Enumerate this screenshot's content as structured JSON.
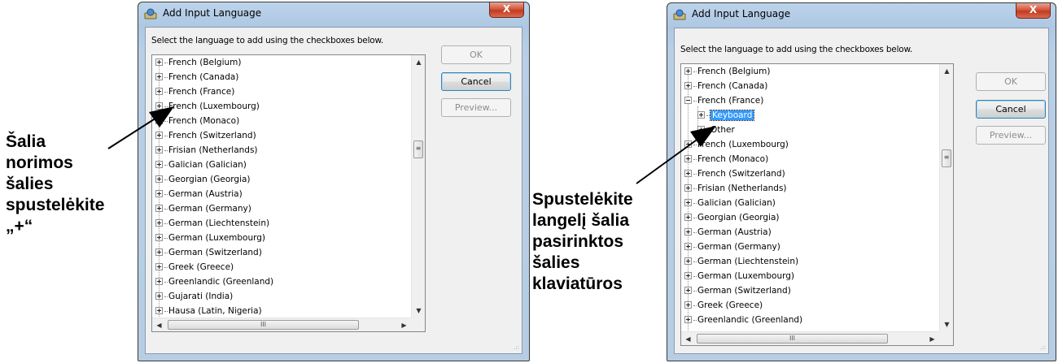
{
  "left_annotation": {
    "lines": [
      "Šalia",
      "norimos",
      "šalies",
      "spustelėkite",
      "„+“"
    ]
  },
  "right_annotation": {
    "lines": [
      "Spustelėkite",
      "langelį šalia",
      "pasirinktos",
      "šalies",
      "klaviatūros"
    ]
  },
  "dialog_left": {
    "title": "Add Input Language",
    "close_label": "X",
    "instruction": "Select the language to add using the checkboxes below.",
    "ok_label": "OK",
    "cancel_label": "Cancel",
    "preview_label": "Preview...",
    "items": [
      "French (Belgium)",
      "French (Canada)",
      "French (France)",
      "French (Luxembourg)",
      "French (Monaco)",
      "French (Switzerland)",
      "Frisian (Netherlands)",
      "Galician (Galician)",
      "Georgian (Georgia)",
      "German (Austria)",
      "German (Germany)",
      "German (Liechtenstein)",
      "German (Luxembourg)",
      "German (Switzerland)",
      "Greek (Greece)",
      "Greenlandic (Greenland)",
      "Gujarati (India)",
      "Hausa (Latin, Nigeria)"
    ]
  },
  "dialog_right": {
    "title": "Add Input Language",
    "close_label": "X",
    "instruction": "Select the language to add using the checkboxes below.",
    "ok_label": "OK",
    "cancel_label": "Cancel",
    "preview_label": "Preview...",
    "items": [
      "French (Belgium)",
      "French (Canada)",
      "French (France)",
      "Keyboard",
      "Other",
      "French (Luxembourg)",
      "French (Monaco)",
      "French (Switzerland)",
      "Frisian (Netherlands)",
      "Galician (Galician)",
      "Georgian (Georgia)",
      "German (Austria)",
      "German (Germany)",
      "German (Liechtenstein)",
      "German (Luxembourg)",
      "German (Switzerland)",
      "Greek (Greece)",
      "Greenlandic (Greenland)"
    ],
    "selected_item": "Keyboard"
  },
  "scroll_thumb_glyph": "III",
  "colors": {
    "titlebar": "#aec8e3",
    "selection": "#3399ff",
    "close_button": "#c23b22"
  }
}
